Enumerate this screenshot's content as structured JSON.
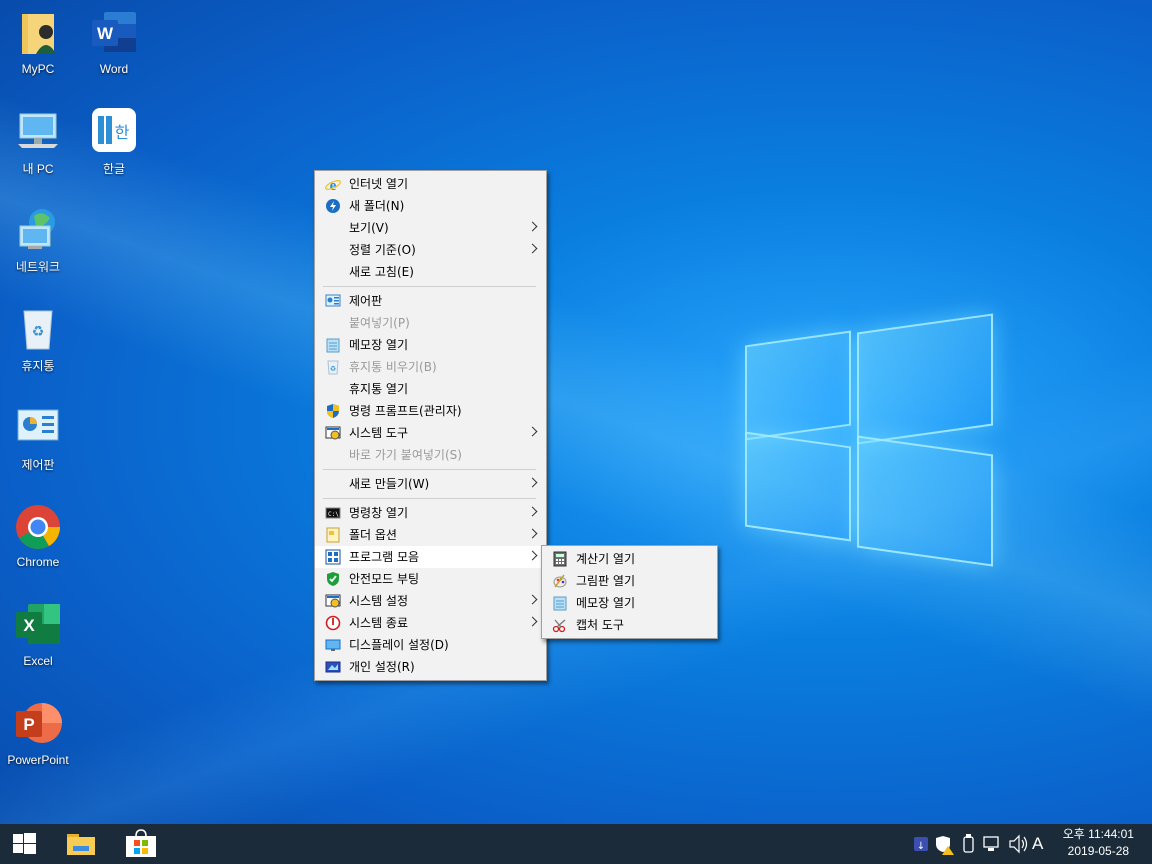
{
  "desktop": {
    "icons": [
      {
        "label": "MyPC",
        "icon": "user-folder-icon"
      },
      {
        "label": "Word",
        "icon": "word-icon"
      },
      {
        "label": "내 PC",
        "icon": "computer-icon"
      },
      {
        "label": "한글",
        "icon": "hangul-icon"
      },
      {
        "label": "네트워크",
        "icon": "network-icon"
      },
      {
        "label": "휴지통",
        "icon": "recycle-bin-icon"
      },
      {
        "label": "제어판",
        "icon": "control-panel-icon"
      },
      {
        "label": "Chrome",
        "icon": "chrome-icon"
      },
      {
        "label": "Excel",
        "icon": "excel-icon"
      },
      {
        "label": "PowerPoint",
        "icon": "powerpoint-icon"
      }
    ]
  },
  "context_menu": {
    "items": [
      {
        "label": "인터넷 열기",
        "icon": "ie-icon"
      },
      {
        "label": "새 폴더(N)",
        "icon": "new-folder-icon"
      },
      {
        "label": "보기(V)",
        "submenu": true
      },
      {
        "label": "정렬 기준(O)",
        "submenu": true
      },
      {
        "label": "새로 고침(E)"
      },
      {
        "label": "제어판",
        "icon": "control-panel-icon"
      },
      {
        "label": "붙여넣기(P)",
        "disabled": true
      },
      {
        "label": "메모장 열기",
        "icon": "notepad-icon"
      },
      {
        "label": "휴지통 비우기(B)",
        "icon": "recycle-icon",
        "disabled": true
      },
      {
        "label": "휴지통 열기"
      },
      {
        "label": "명령 프롬프트(관리자)",
        "icon": "shield-icon"
      },
      {
        "label": "시스템 도구",
        "icon": "system-tools-icon",
        "submenu": true
      },
      {
        "label": "바로 가기 붙여넣기(S)",
        "disabled": true
      },
      {
        "label": "새로 만들기(W)",
        "submenu": true
      },
      {
        "label": "명령창 열기",
        "icon": "cmd-icon",
        "submenu": true
      },
      {
        "label": "폴더 옵션",
        "icon": "folder-options-icon",
        "submenu": true
      },
      {
        "label": "프로그램 모음",
        "icon": "programs-icon",
        "submenu": true,
        "active": true
      },
      {
        "label": "안전모드 부팅",
        "icon": "safe-mode-icon"
      },
      {
        "label": "시스템 설정",
        "icon": "system-settings-icon",
        "submenu": true
      },
      {
        "label": "시스템 종료",
        "icon": "shutdown-icon",
        "submenu": true
      },
      {
        "label": "디스플레이 설정(D)",
        "icon": "display-icon"
      },
      {
        "label": "개인 설정(R)",
        "icon": "personalize-icon"
      }
    ]
  },
  "submenu": {
    "items": [
      {
        "label": "계산기 열기",
        "icon": "calculator-icon"
      },
      {
        "label": "그림판 열기",
        "icon": "paint-icon"
      },
      {
        "label": "메모장 열기",
        "icon": "notepad-icon"
      },
      {
        "label": "캡처 도구",
        "icon": "snipping-tool-icon"
      }
    ]
  },
  "taskbar": {
    "ime": "A",
    "clock": {
      "time": "오후 11:44:01",
      "date": "2019-05-28"
    }
  },
  "colors": {
    "taskbar": "#1b2b3a",
    "menu_bg": "#f2f2f2",
    "accent": "#0a7fe0"
  }
}
